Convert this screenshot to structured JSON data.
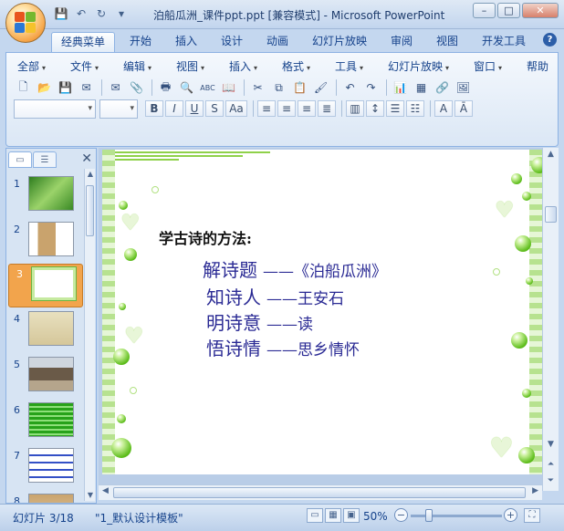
{
  "window": {
    "title": "泊船瓜洲_课件ppt.ppt [兼容模式] - Microsoft PowerPoint",
    "buttons": {
      "minimize": "–",
      "maximize": "□",
      "close": "✕"
    }
  },
  "quick_access": {
    "save": "💾",
    "undo": "↶",
    "redo": "↻",
    "customize": "▾"
  },
  "ribbon_tabs": [
    {
      "label": "经典菜单",
      "active": true
    },
    {
      "label": "开始"
    },
    {
      "label": "插入"
    },
    {
      "label": "设计"
    },
    {
      "label": "动画"
    },
    {
      "label": "幻灯片放映"
    },
    {
      "label": "审阅"
    },
    {
      "label": "视图"
    },
    {
      "label": "开发工具"
    }
  ],
  "help_label": "?",
  "classic_menu": [
    "全部",
    "文件",
    "编辑",
    "视图",
    "插入",
    "格式",
    "工具",
    "幻灯片放映",
    "窗口",
    "帮助"
  ],
  "toolbar_icons": {
    "new": "🗋",
    "open": "📂",
    "save": "💾",
    "permission": "✉",
    "email": "✉",
    "attach": "📎",
    "print": "🖶",
    "preview": "🔍",
    "spell": "ABC",
    "research": "📖",
    "cut": "✂",
    "copy": "⧉",
    "paste": "📋",
    "format_painter": "🖌",
    "undo": "↶",
    "redo": "↷",
    "chart": "📊",
    "table": "▦",
    "hyperlink": "🔗",
    "picture": "🖼"
  },
  "format_buttons": {
    "bold": "B",
    "italic": "I",
    "underline": "U",
    "strike": "S",
    "case": "Aa"
  },
  "slide_panel": {
    "tabs": [
      "▭",
      "☰"
    ],
    "close": "✕",
    "slides": [
      {
        "num": "1"
      },
      {
        "num": "2"
      },
      {
        "num": "3",
        "selected": true
      },
      {
        "num": "4"
      },
      {
        "num": "5"
      },
      {
        "num": "6"
      },
      {
        "num": "7"
      },
      {
        "num": "8"
      }
    ]
  },
  "slide": {
    "heading": "学古诗的方法:",
    "lines": [
      {
        "left": "解诗题",
        "right": "——《泊船瓜洲》"
      },
      {
        "left": "知诗人",
        "right": "——王安石"
      },
      {
        "left": "明诗意",
        "right": "——读"
      },
      {
        "left": "悟诗情",
        "right": "——思乡情怀"
      }
    ]
  },
  "status": {
    "slide_info": "幻灯片 3/18",
    "template": "\"1_默认设计模板\"",
    "zoom": "50%"
  },
  "colors": {
    "accent": "#15428b",
    "slide_text": "#2a2a94",
    "green": "#5fbe1d"
  }
}
